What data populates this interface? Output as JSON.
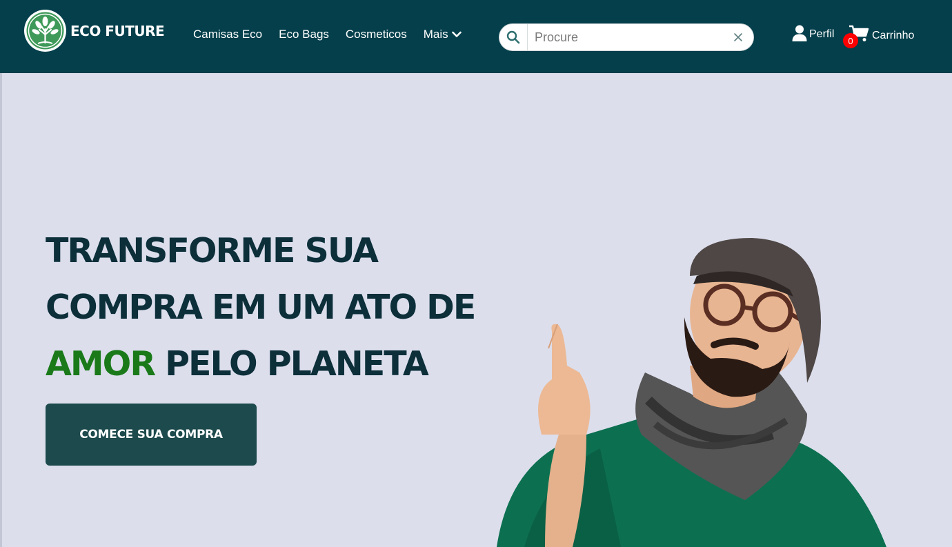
{
  "brand": {
    "name": "ECO FUTURE"
  },
  "nav": {
    "items": [
      "Camisas Eco",
      "Eco Bags",
      "Cosmeticos"
    ],
    "more_label": "Mais"
  },
  "search": {
    "placeholder": "Procure",
    "value": ""
  },
  "account": {
    "profile_label": "Perfil",
    "cart_label": "Carrinho",
    "cart_count": "0"
  },
  "hero": {
    "title_line1": "TRANSFORME SUA",
    "title_line2": "COMPRA EM UM ATO DE",
    "title_highlight": "AMOR",
    "title_line3_rest": " PELO PLANETA",
    "cta_label": "COMECE SUA COMPRA"
  },
  "colors": {
    "header_bg": "#043f4b",
    "hero_bg": "#dcdeec",
    "title": "#0c2f3a",
    "highlight": "#1a7a1a",
    "cta_bg": "#1d4a4c",
    "badge": "#ff0000"
  }
}
